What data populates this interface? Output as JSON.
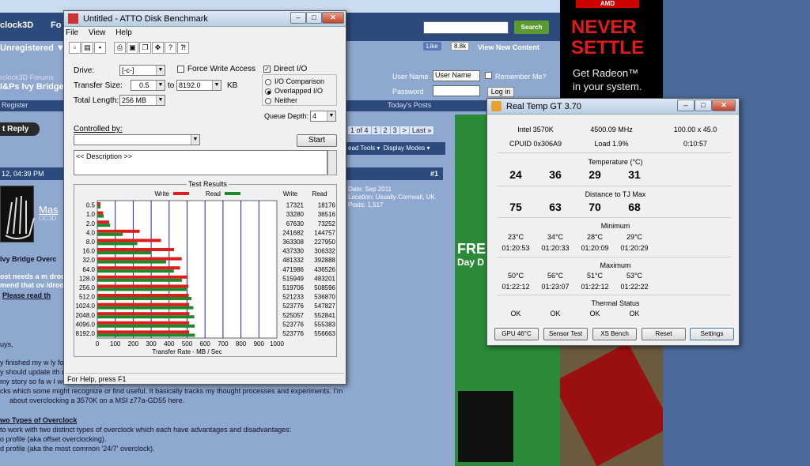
{
  "forum": {
    "brand": "clock3D",
    "tab": "Fo",
    "unregistered": "Unregistered ▼",
    "search_button": "Search",
    "like": "Like",
    "like_count": "8.8k",
    "new_content": "View New Content",
    "crumb_top": "rclock3D Forums",
    "crumb_title": "I&Ps Ivy Bridge",
    "username_label": "User Name",
    "username_value": "User Name",
    "remember_me": "Remember Me?",
    "password_label": "Password",
    "login_button": "Log in",
    "register": "Register",
    "todays_posts": "Today's Posts",
    "reply": "t Reply",
    "pager": [
      "1 of 4",
      "1",
      "2",
      "3",
      ">",
      "Last »"
    ],
    "thread_tools": "ead Tools ▾",
    "display_modes": "Display Modes ▾",
    "post_date": "12, 04:39 PM",
    "post_number": "#1",
    "username": "Mas",
    "user_title": "OC3D",
    "meta": [
      "Date: Sep 2011",
      "Location: Usually Cornwall, UK",
      "Posts: 1,517"
    ],
    "post_lines": [
      "Ivy Bridge Overc",
      "ost needs a m                                                                                              droop. I therefore",
      "mend that ov                                                                                              /droop is a good",
      "Please read th",
      "",
      "uys,",
      "",
      "y finished my w                                                                                          ly for several months",
      "y should update                                                                                          ith overclocking and",
      "my story so fa                                                                                          w I went about my",
      "cks which some might recognize or find useful. It basically tracks my thought processes and experiments. I'm",
      "about overclocking a 3570K on a MSI z77a-GD55 here.",
      "",
      "wo Types of Overclock",
      "to work with two distinct types of overclock which each have advantages and disadvantages:",
      "o profile (aka offset overclocking).",
      "d profile (aka the most common '24/7' overclock)."
    ]
  },
  "ad_green": {
    "line1": "FRE",
    "line2": "Day D"
  },
  "ad_amd": {
    "logo": "AMD",
    "headline1": "NEVER",
    "headline2": "SETTLE",
    "sub1": "Get Radeon™",
    "sub2": "in your system."
  },
  "atto": {
    "title": "Untitled - ATTO Disk Benchmark",
    "menu": [
      "File",
      "View",
      "Help"
    ],
    "drive_label": "Drive:",
    "drive_value": "[-c-]",
    "force_write": "Force Write Access",
    "direct_io": "Direct I/O",
    "transfer_size_label": "Transfer Size:",
    "transfer_from": "0.5",
    "to_label": "to",
    "transfer_to": "8192.0",
    "kb_label": "KB",
    "io_comparison": "I/O Comparison",
    "overlapped_io": "Overlapped I/O",
    "neither": "Neither",
    "total_length_label": "Total Length:",
    "total_length_value": "256 MB",
    "queue_depth_label": "Queue Depth:",
    "queue_depth_value": "4",
    "controlled_by_label": "Controlled by:",
    "start_button": "Start",
    "description": "<< Description >>",
    "results_label": "Test Results",
    "write_legend": "Write",
    "read_legend": "Read",
    "col_write": "Write",
    "col_read": "Read",
    "x_label": "Transfer Rate - MB / Sec",
    "status": "For Help, press F1",
    "write_color": "#e01b1b",
    "read_color": "#1c8a2a"
  },
  "chart_data": {
    "type": "bar",
    "categories": [
      "0.5",
      "1.0",
      "2.0",
      "4.0",
      "8.0",
      "16.0",
      "32.0",
      "64.0",
      "128.0",
      "256.0",
      "512.0",
      "1024.0",
      "2048.0",
      "4096.0",
      "8192.0"
    ],
    "series": [
      {
        "name": "Write",
        "values": [
          17321,
          33280,
          67630,
          241682,
          363308,
          437330,
          481332,
          471986,
          515949,
          519706,
          521233,
          523776,
          525057,
          523776,
          523776
        ]
      },
      {
        "name": "Read",
        "values": [
          18176,
          36516,
          73252,
          144757,
          227950,
          306332,
          392888,
          436526,
          483201,
          508596,
          536870,
          547827,
          552841,
          555383,
          556663
        ]
      }
    ],
    "x_ticks": [
      "0",
      "100",
      "200",
      "300",
      "400",
      "500",
      "600",
      "700",
      "800",
      "900",
      "1000"
    ],
    "xlim": [
      0,
      1000
    ],
    "xlabel": "Transfer Rate - MB / Sec"
  },
  "realtemp": {
    "title": "Real Temp GT 3.70",
    "cpu": "Intel 3570K",
    "mhz": "4500.09 MHz",
    "mult": "100.00 x 45.0",
    "cpuid": "CPUID  0x306A9",
    "load": "Load  1.9%",
    "time": "0:10:57",
    "temp_label": "Temperature (°C)",
    "temps": [
      "24",
      "36",
      "29",
      "31"
    ],
    "dist_label": "Distance to TJ Max",
    "dists": [
      "75",
      "63",
      "70",
      "68"
    ],
    "min_label": "Minimum",
    "min_temps": [
      "23°C",
      "34°C",
      "28°C",
      "29°C"
    ],
    "min_times": [
      "01:20:53",
      "01:20:33",
      "01:20:09",
      "01:20:29"
    ],
    "max_label": "Maximum",
    "max_temps": [
      "50°C",
      "56°C",
      "51°C",
      "53°C"
    ],
    "max_times": [
      "01:22:12",
      "01:23:07",
      "01:22:12",
      "01:22:22"
    ],
    "thermal_label": "Thermal Status",
    "thermal": [
      "OK",
      "OK",
      "OK",
      "OK"
    ],
    "buttons": [
      "GPU  46°C",
      "Sensor Test",
      "XS Bench",
      "Reset",
      "Settings"
    ]
  }
}
